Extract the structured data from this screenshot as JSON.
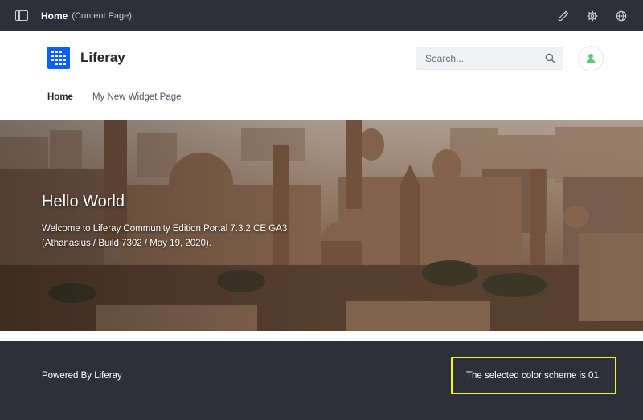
{
  "control_menu": {
    "title": "Home",
    "subtitle": "(Content Page)",
    "icons": [
      "product-menu-toggle-icon",
      "pencil-icon",
      "gear-icon",
      "globe-icon"
    ]
  },
  "header": {
    "site_name": "Liferay",
    "search_placeholder": "Search...",
    "nav": [
      {
        "label": "Home",
        "active": true
      },
      {
        "label": "My New Widget Page",
        "active": false
      }
    ]
  },
  "hero": {
    "title": "Hello World",
    "text": "Welcome to Liferay Community Edition Portal 7.3.2 CE GA3 (Athanasius / Build 7302 / May 19, 2020)."
  },
  "footer": {
    "powered_by": "Powered By Liferay",
    "color_scheme_text": "The selected color scheme is 01."
  },
  "colors": {
    "dark_bar": "#2d2f3b",
    "brand_blue": "#0b5fff",
    "user_green": "#5aca75",
    "highlight_yellow": "#f3f31a"
  }
}
